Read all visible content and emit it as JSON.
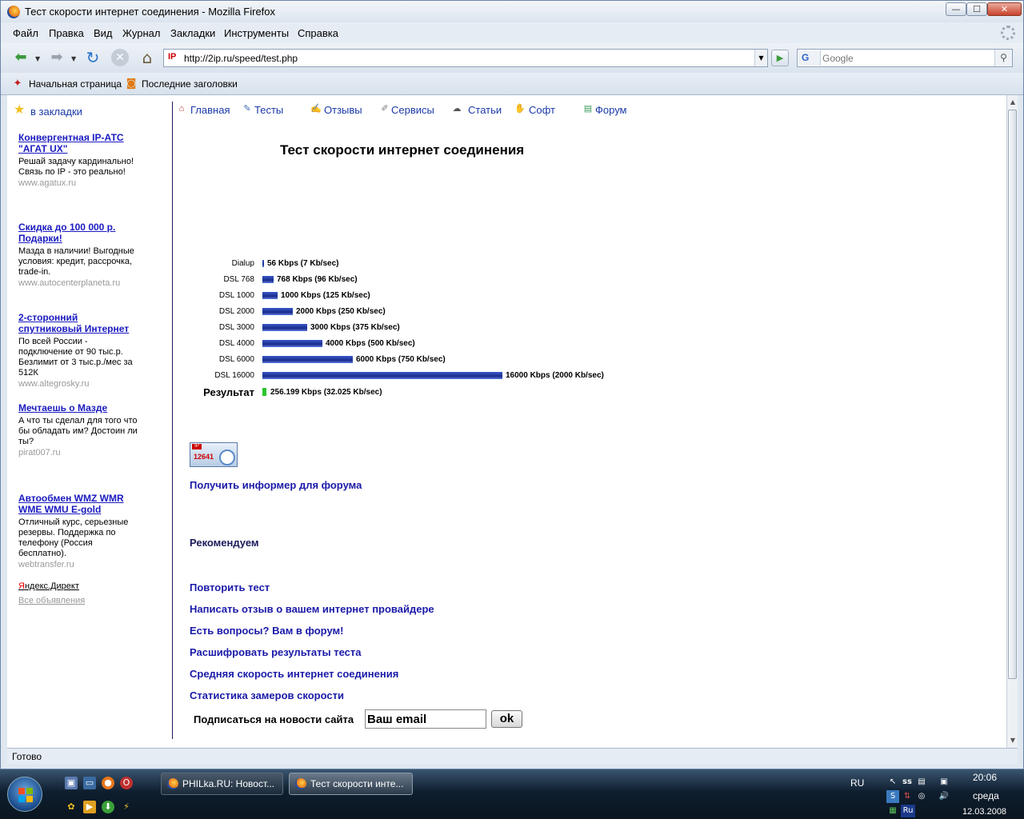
{
  "window": {
    "title": "Тест скорости интернет соединения - Mozilla Firefox",
    "min": "—",
    "max": "☐",
    "close": "✕"
  },
  "menu": [
    "Файл",
    "Правка",
    "Вид",
    "Журнал",
    "Закладки",
    "Инструменты",
    "Справка"
  ],
  "nav": {
    "url": "http://2ip.ru/speed/test.php",
    "site_icon": "IP",
    "search_engine": "G",
    "search_placeholder": "Google"
  },
  "bookmarks_bar": {
    "items": [
      "Начальная страница",
      "Последние заголовки"
    ]
  },
  "sidebar": {
    "bookmark_link": "в закладки",
    "ads": [
      {
        "title": "Конвергентная IP-АТС \"АГАТ UX\"",
        "text": "Решай задачу кардинально! Связь по IP - это реально!",
        "url": "www.agatux.ru"
      },
      {
        "title": "Скидка до 100 000 р. Подарки!",
        "text": "Мазда в наличии! Выгодные условия: кредит, рассрочка, trade-in.",
        "url": "www.autocenterplaneta.ru"
      },
      {
        "title": "2-сторонний спутниковый Интернет",
        "text": "По всей России - подключение от 90 тыс.р. Безлимит от 3 тыс.р./мес за 512К",
        "url": "www.altegrosky.ru"
      },
      {
        "title": "Мечтаешь о Мазде",
        "text": "А что ты сделал для того что бы обладать им? Достоин ли ты?",
        "url": "pirat007.ru"
      },
      {
        "title": "Автообмен WMZ WMR WME WMU E-gold",
        "text": "Отличный курс, серьезные резервы. Поддержка по телефону (Россия бесплатно).",
        "url": "webtransfer.ru"
      }
    ],
    "yandex_prefix": "Я",
    "yandex_rest": "ндекс.Директ",
    "all_ads": "Все объявления"
  },
  "site_nav": [
    "Главная",
    "Тесты",
    "Отзывы",
    "Сервисы",
    "Статьи",
    "Софт",
    "Форум"
  ],
  "page_title": "Тест скорости интернет соединения",
  "speed_chart": {
    "rows": [
      {
        "label": "Dialup",
        "text": "56 Kbps (7 Kb/sec)",
        "kbps": 56
      },
      {
        "label": "DSL 768",
        "text": "768 Kbps (96 Kb/sec)",
        "kbps": 768
      },
      {
        "label": "DSL 1000",
        "text": "1000 Kbps (125 Kb/sec)",
        "kbps": 1000
      },
      {
        "label": "DSL 2000",
        "text": "2000 Kbps (250 Kb/sec)",
        "kbps": 2000
      },
      {
        "label": "DSL 3000",
        "text": "3000 Kbps (375 Kb/sec)",
        "kbps": 3000
      },
      {
        "label": "DSL 4000",
        "text": "4000 Kbps (500 Kb/sec)",
        "kbps": 4000
      },
      {
        "label": "DSL 6000",
        "text": "6000 Kbps (750 Kb/sec)",
        "kbps": 6000
      },
      {
        "label": "DSL 16000",
        "text": "16000 Kbps (2000 Kb/sec)",
        "kbps": 16000
      }
    ],
    "result": {
      "label": "Результат",
      "text": "256.199 Kbps (32.025 Kb/sec)",
      "kbps": 256.199
    },
    "max_kbps": 16000
  },
  "informer": {
    "logo": "IP",
    "number": "12641"
  },
  "informer_link": "Получить информер для форума",
  "recommend": "Рекомендуем",
  "links": [
    "Повторить тест",
    "Написать отзыв о вашем интернет провайдере",
    "Есть вопросы? Вам в форум!",
    "Расшифровать результаты теста",
    "Средняя скорость интернет соединения",
    "Статистика замеров скорости"
  ],
  "subscribe": {
    "label": "Подписаться на новости сайта",
    "email_value": "Ваш email",
    "ok": "ok"
  },
  "status": "Готово",
  "taskbar": {
    "tasks": [
      "PHILka.RU: Новост...",
      "Тест скорости инте..."
    ],
    "lang": "RU",
    "tray_lang": "Ru",
    "time": "20:06",
    "day": "среда",
    "date": "12.03.2008"
  }
}
